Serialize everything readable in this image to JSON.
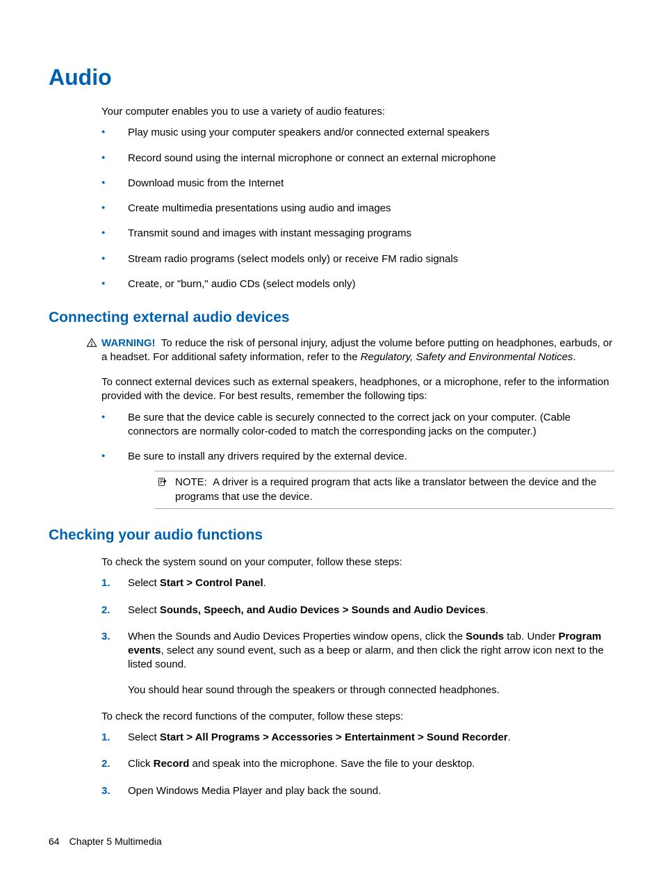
{
  "title": "Audio",
  "intro": "Your computer enables you to use a variety of audio features:",
  "features": [
    "Play music using your computer speakers and/or connected external speakers",
    "Record sound using the internal microphone or connect an external microphone",
    "Download music from the Internet",
    "Create multimedia presentations using audio and images",
    "Transmit sound and images with instant messaging programs",
    "Stream radio programs (select models only) or receive FM radio signals",
    "Create, or \"burn,\" audio CDs (select models only)"
  ],
  "section1": {
    "heading": "Connecting external audio devices",
    "warning_label": "WARNING!",
    "warning_text_1": "To reduce the risk of personal injury, adjust the volume before putting on headphones, earbuds, or a headset. For additional safety information, refer to the ",
    "warning_italic": "Regulatory, Safety and Environmental Notices",
    "warning_text_2": ".",
    "para": "To connect external devices such as external speakers, headphones, or a microphone, refer to the information provided with the device. For best results, remember the following tips:",
    "tips": [
      "Be sure that the device cable is securely connected to the correct jack on your computer. (Cable connectors are normally color-coded to match the corresponding jacks on the computer.)",
      "Be sure to install any drivers required by the external device."
    ],
    "note_label": "NOTE:",
    "note_text": "A driver is a required program that acts like a translator between the device and the programs that use the device."
  },
  "section2": {
    "heading": "Checking your audio functions",
    "para1": "To check the system sound on your computer, follow these steps:",
    "steps1": {
      "s1_pre": "Select ",
      "s1_bold": "Start > Control Panel",
      "s1_post": ".",
      "s2_pre": "Select ",
      "s2_bold": "Sounds, Speech, and Audio Devices > Sounds and Audio Devices",
      "s2_post": ".",
      "s3_pre": "When the Sounds and Audio Devices Properties window opens, click the ",
      "s3_bold1": "Sounds",
      "s3_mid": " tab. Under ",
      "s3_bold2": "Program events",
      "s3_post": ", select any sound event, such as a beep or alarm, and then click the right arrow icon next to the listed sound.",
      "s3_sub": "You should hear sound through the speakers or through connected headphones."
    },
    "para2": "To check the record functions of the computer, follow these steps:",
    "steps2": {
      "s1_pre": "Select ",
      "s1_bold": "Start > All Programs > Accessories > Entertainment > Sound Recorder",
      "s1_post": ".",
      "s2_pre": "Click ",
      "s2_bold": "Record",
      "s2_post": " and speak into the microphone. Save the file to your desktop.",
      "s3": "Open Windows Media Player and play back the sound."
    }
  },
  "footer": {
    "page": "64",
    "chapter": "Chapter 5   Multimedia"
  }
}
